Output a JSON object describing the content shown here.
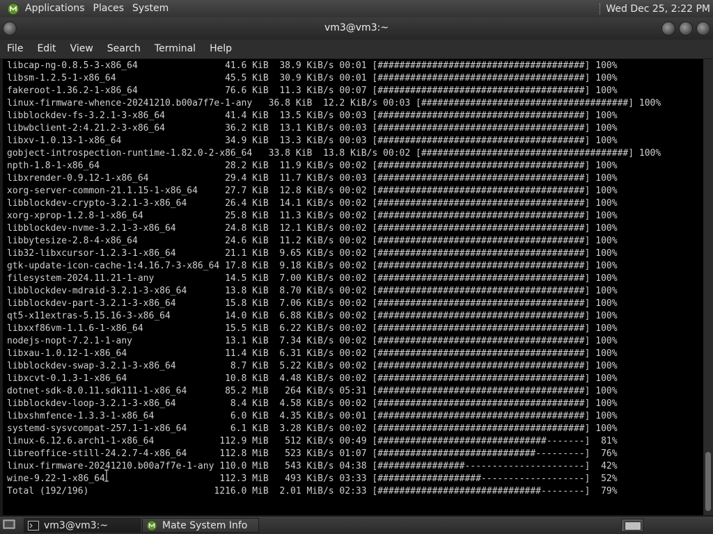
{
  "top_panel": {
    "menus": [
      "Applications",
      "Places",
      "System"
    ],
    "clock": "Wed Dec 25,  2:22 PM"
  },
  "window": {
    "title": "vm3@vm3:~"
  },
  "menubar": [
    "File",
    "Edit",
    "View",
    "Search",
    "Terminal",
    "Help"
  ],
  "terminal": {
    "lines": [
      "libcap-ng-0.8.5-3-x86_64                41.6 KiB  38.9 KiB/s 00:01 [######################################] 100%",
      "libsm-1.2.5-1-x86_64                    45.5 KiB  30.9 KiB/s 00:01 [######################################] 100%",
      "fakeroot-1.36.2-1-x86_64                76.6 KiB  11.3 KiB/s 00:07 [######################################] 100%",
      "linux-firmware-whence-20241210.b00a7f7e-1-any   36.8 KiB  12.2 KiB/s 00:03 [######################################] 100%",
      "libblockdev-fs-3.2.1-3-x86_64           41.4 KiB  13.5 KiB/s 00:03 [######################################] 100%",
      "libwbclient-2:4.21.2-3-x86_64           36.2 KiB  13.1 KiB/s 00:03 [######################################] 100%",
      "libxv-1.0.13-1-x86_64                   34.9 KiB  13.3 KiB/s 00:03 [######################################] 100%",
      "gobject-introspection-runtime-1.82.0-2-x86_64   33.8 KiB  13.8 KiB/s 00:02 [######################################] 100%",
      "npth-1.8-1-x86_64                       28.2 KiB  11.9 KiB/s 00:02 [######################################] 100%",
      "libxrender-0.9.12-1-x86_64              29.4 KiB  11.7 KiB/s 00:03 [######################################] 100%",
      "xorg-server-common-21.1.15-1-x86_64     27.7 KiB  12.8 KiB/s 00:02 [######################################] 100%",
      "libblockdev-crypto-3.2.1-3-x86_64       26.4 KiB  14.1 KiB/s 00:02 [######################################] 100%",
      "xorg-xprop-1.2.8-1-x86_64               25.8 KiB  11.3 KiB/s 00:02 [######################################] 100%",
      "libblockdev-nvme-3.2.1-3-x86_64         24.8 KiB  12.1 KiB/s 00:02 [######################################] 100%",
      "libbytesize-2.8-4-x86_64                24.6 KiB  11.2 KiB/s 00:02 [######################################] 100%",
      "lib32-libxcursor-1.2.3-1-x86_64         21.1 KiB  9.65 KiB/s 00:02 [######################################] 100%",
      "gtk-update-icon-cache-1:4.16.7-3-x86_64 17.8 KiB  9.18 KiB/s 00:02 [######################################] 100%",
      "filesystem-2024.11.21-1-any             14.5 KiB  7.00 KiB/s 00:02 [######################################] 100%",
      "libblockdev-mdraid-3.2.1-3-x86_64       13.8 KiB  8.70 KiB/s 00:02 [######################################] 100%",
      "libblockdev-part-3.2.1-3-x86_64         15.8 KiB  7.06 KiB/s 00:02 [######################################] 100%",
      "qt5-x11extras-5.15.16-3-x86_64          14.0 KiB  6.88 KiB/s 00:02 [######################################] 100%",
      "libxxf86vm-1.1.6-1-x86_64               15.5 KiB  6.22 KiB/s 00:02 [######################################] 100%",
      "nodejs-nopt-7.2.1-1-any                 13.1 KiB  7.34 KiB/s 00:02 [######################################] 100%",
      "libxau-1.0.12-1-x86_64                  11.4 KiB  6.31 KiB/s 00:02 [######################################] 100%",
      "libblockdev-swap-3.2.1-3-x86_64          8.7 KiB  5.22 KiB/s 00:02 [######################################] 100%",
      "libxcvt-0.1.3-1-x86_64                  10.8 KiB  4.48 KiB/s 00:02 [######################################] 100%",
      "dotnet-sdk-8.0.11.sdk111-1-x86_64       85.2 MiB   264 KiB/s 05:31 [######################################] 100%",
      "libblockdev-loop-3.2.1-3-x86_64          8.4 KiB  4.58 KiB/s 00:02 [######################################] 100%",
      "libxshmfence-1.3.3-1-x86_64              6.0 KiB  4.35 KiB/s 00:01 [######################################] 100%",
      "systemd-sysvcompat-257.1-1-x86_64        6.1 KiB  3.28 KiB/s 00:02 [######################################] 100%",
      "linux-6.12.6.arch1-1-x86_64            112.9 MiB   512 KiB/s 00:49 [###############################-------]  81%",
      "libreoffice-still-24.2.7-4-x86_64      112.8 MiB   523 KiB/s 01:07 [#############################---------]  76%",
      "linux-firmware-20241210.b00a7f7e-1-any 110.0 MiB   543 KiB/s 04:38 [################----------------------]  42%",
      "wine-9.22-1-x86_64                     112.3 MiB   493 KiB/s 03:33 [###################-------------------]  52%",
      "Total (192/196)                       1216.0 MiB  2.01 MiB/s 02:33 [##############################--------]  79%"
    ]
  },
  "taskbar": {
    "tasks": [
      "vm3@vm3:~",
      "Mate System Info"
    ]
  },
  "icons": {
    "menu_logo": "mate-logo-icon",
    "terminal_task": "terminal-icon",
    "sysinfo_task": "system-info-icon",
    "show_desktop": "show-desktop-icon",
    "workspace": "workspace-switcher-icon"
  },
  "colors": {
    "terminal_bg": "#000000",
    "terminal_fg": "#d0d0d0",
    "panel": "#3a3a3a"
  }
}
